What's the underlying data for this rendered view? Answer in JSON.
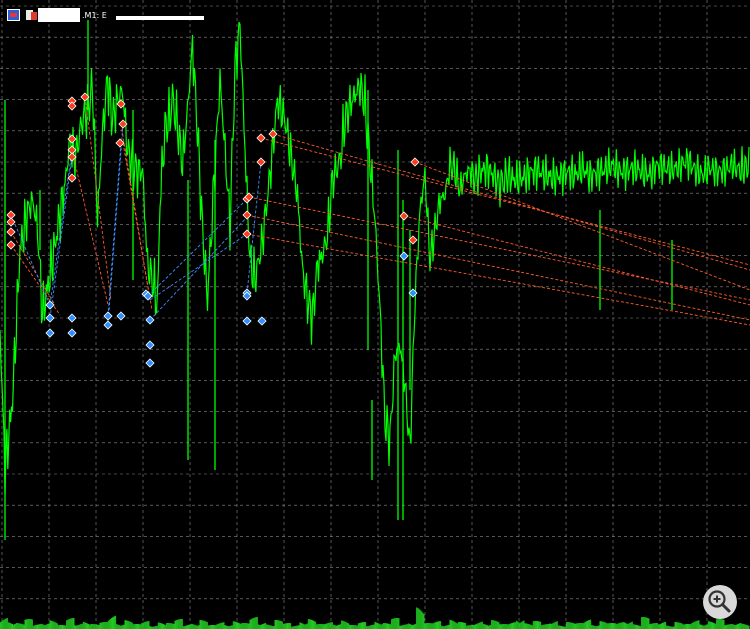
{
  "window": {
    "symbol_label": ".M1: E",
    "chart_icon": "chart-window-icon",
    "doc_icon": "document-icon",
    "zoom_icon": "zoom-in-icon"
  },
  "colors": {
    "background": "#000000",
    "grid": "#8a8a8a",
    "price": "#00ff00",
    "volume": "#22cc22",
    "high_marker": "#ff3b1f",
    "low_marker": "#2f8fff",
    "high_trendline": "#ff5a2a",
    "low_trendline": "#3b8fff"
  },
  "chart_data": {
    "type": "line",
    "title": "",
    "xlabel": "",
    "ylabel": "",
    "grid": true,
    "price_series": [
      [
        0,
        330
      ],
      [
        0.02,
        470
      ],
      [
        0.05,
        400
      ],
      [
        0.08,
        250
      ],
      [
        0.11,
        212
      ],
      [
        0.13,
        200
      ],
      [
        0.15,
        228
      ],
      [
        0.17,
        315
      ],
      [
        0.2,
        275
      ],
      [
        0.23,
        230
      ],
      [
        0.26,
        184
      ],
      [
        0.28,
        140
      ],
      [
        0.3,
        160
      ],
      [
        0.33,
        118
      ],
      [
        0.35,
        112
      ],
      [
        0.37,
        86
      ],
      [
        0.39,
        220
      ],
      [
        0.41,
        132
      ],
      [
        0.43,
        80
      ],
      [
        0.45,
        120
      ],
      [
        0.47,
        100
      ],
      [
        0.49,
        90
      ],
      [
        0.51,
        150
      ],
      [
        0.53,
        165
      ],
      [
        0.55,
        172
      ],
      [
        0.57,
        170
      ],
      [
        0.59,
        265
      ],
      [
        0.61,
        280
      ],
      [
        0.63,
        305
      ],
      [
        0.64,
        200
      ],
      [
        0.66,
        130
      ],
      [
        0.68,
        115
      ],
      [
        0.69,
        100
      ],
      [
        0.71,
        125
      ],
      [
        0.73,
        165
      ],
      [
        0.75,
        110
      ],
      [
        0.77,
        45
      ],
      [
        0.79,
        130
      ],
      [
        0.81,
        230
      ],
      [
        0.83,
        300
      ],
      [
        0.84,
        255
      ],
      [
        0.86,
        165
      ],
      [
        0.88,
        80
      ],
      [
        0.9,
        150
      ],
      [
        0.92,
        225
      ],
      [
        0.94,
        70
      ],
      [
        0.96,
        24
      ],
      [
        0.98,
        150
      ],
      [
        1.0,
        260
      ],
      [
        1.02,
        280
      ],
      [
        1.05,
        240
      ],
      [
        1.08,
        175
      ],
      [
        1.11,
        100
      ],
      [
        1.14,
        120
      ],
      [
        1.17,
        165
      ],
      [
        1.19,
        195
      ],
      [
        1.21,
        270
      ],
      [
        1.23,
        300
      ],
      [
        1.25,
        318
      ],
      [
        1.27,
        265
      ],
      [
        1.29,
        255
      ],
      [
        1.31,
        235
      ],
      [
        1.33,
        180
      ],
      [
        1.36,
        160
      ],
      [
        1.38,
        120
      ],
      [
        1.4,
        105
      ],
      [
        1.42,
        95
      ],
      [
        1.44,
        85
      ],
      [
        1.46,
        105
      ],
      [
        1.48,
        160
      ],
      [
        1.5,
        220
      ],
      [
        1.52,
        310
      ],
      [
        1.54,
        420
      ],
      [
        1.56,
        440
      ],
      [
        1.58,
        355
      ],
      [
        1.6,
        345
      ],
      [
        1.62,
        385
      ],
      [
        1.64,
        450
      ],
      [
        1.66,
        300
      ],
      [
        1.68,
        210
      ],
      [
        1.7,
        175
      ],
      [
        1.72,
        260
      ],
      [
        1.74,
        230
      ],
      [
        1.76,
        200
      ],
      [
        1.78,
        195
      ],
      [
        1.8,
        165
      ],
      [
        1.82,
        170
      ],
      [
        1.84,
        190
      ],
      [
        1.86,
        175
      ],
      [
        1.88,
        170
      ],
      [
        1.9,
        180
      ],
      [
        1.92,
        172
      ],
      [
        1.95,
        168
      ],
      [
        1.98,
        178
      ],
      [
        2.0,
        185
      ],
      [
        2.03,
        175
      ],
      [
        2.06,
        180
      ],
      [
        2.09,
        178
      ],
      [
        2.12,
        172
      ],
      [
        2.15,
        170
      ],
      [
        2.18,
        175
      ],
      [
        2.21,
        178
      ],
      [
        2.24,
        176
      ],
      [
        2.27,
        172
      ],
      [
        2.3,
        175
      ],
      [
        2.33,
        168
      ],
      [
        2.36,
        176
      ],
      [
        2.39,
        172
      ],
      [
        2.42,
        170
      ],
      [
        2.45,
        165
      ],
      [
        2.48,
        172
      ],
      [
        2.51,
        170
      ],
      [
        2.54,
        168
      ],
      [
        2.57,
        172
      ],
      [
        2.6,
        175
      ],
      [
        2.63,
        165
      ],
      [
        2.66,
        168
      ],
      [
        2.69,
        170
      ],
      [
        2.72,
        166
      ],
      [
        2.75,
        160
      ],
      [
        2.78,
        170
      ],
      [
        2.81,
        175
      ],
      [
        2.84,
        168
      ],
      [
        2.87,
        172
      ],
      [
        2.9,
        170
      ],
      [
        2.93,
        165
      ],
      [
        2.96,
        170
      ],
      [
        3.0,
        165
      ]
    ],
    "volume_bars": [
      12,
      8,
      6,
      10,
      5,
      7,
      9,
      4,
      11,
      6,
      8,
      5,
      7,
      14,
      6,
      9,
      5,
      8,
      4,
      7,
      6,
      10,
      5,
      6,
      9,
      4,
      7,
      5,
      8,
      6,
      12,
      7,
      5,
      9,
      6,
      4,
      8,
      10,
      5,
      7,
      6,
      9,
      4,
      7,
      5,
      8,
      6,
      11,
      5,
      7,
      22,
      6,
      8,
      5,
      10,
      7,
      4,
      8,
      6,
      9,
      5,
      7,
      11,
      6,
      8,
      5,
      9,
      4,
      7,
      6,
      10,
      5,
      8,
      6,
      7,
      9,
      5,
      12,
      6,
      8,
      4,
      7,
      5,
      9,
      6,
      8,
      10,
      5,
      7,
      6
    ],
    "high_markers": [
      [
        11,
        215
      ],
      [
        11,
        222
      ],
      [
        11,
        232
      ],
      [
        11,
        245
      ],
      [
        72,
        101
      ],
      [
        72,
        106
      ],
      [
        72,
        139
      ],
      [
        72,
        150
      ],
      [
        72,
        157
      ],
      [
        72,
        178
      ],
      [
        85,
        97
      ],
      [
        121,
        104
      ],
      [
        123,
        124
      ],
      [
        120,
        143
      ],
      [
        261,
        138
      ],
      [
        261,
        162
      ],
      [
        273,
        134
      ],
      [
        247,
        199
      ],
      [
        249,
        197
      ],
      [
        247,
        215
      ],
      [
        247,
        234
      ],
      [
        404,
        216
      ],
      [
        413,
        240
      ],
      [
        415,
        162
      ]
    ],
    "low_markers": [
      [
        50,
        305
      ],
      [
        50,
        318
      ],
      [
        50,
        333
      ],
      [
        72,
        318
      ],
      [
        72,
        333
      ],
      [
        108,
        316
      ],
      [
        108,
        325
      ],
      [
        121,
        316
      ],
      [
        146,
        294
      ],
      [
        148,
        296
      ],
      [
        150,
        320
      ],
      [
        150,
        345
      ],
      [
        150,
        363
      ],
      [
        247,
        293
      ],
      [
        247,
        296
      ],
      [
        247,
        321
      ],
      [
        262,
        321
      ],
      [
        404,
        256
      ],
      [
        413,
        293
      ]
    ],
    "high_trendlines": [
      [
        [
          11,
          232
        ],
        [
          55,
          305
        ]
      ],
      [
        [
          11,
          245
        ],
        [
          60,
          315
        ]
      ],
      [
        [
          72,
          150
        ],
        [
          108,
          305
        ]
      ],
      [
        [
          85,
          97
        ],
        [
          111,
          300
        ]
      ],
      [
        [
          121,
          124
        ],
        [
          150,
          300
        ]
      ],
      [
        [
          123,
          143
        ],
        [
          152,
          310
        ]
      ],
      [
        [
          261,
          138
        ],
        [
          750,
          265
        ]
      ],
      [
        [
          273,
          134
        ],
        [
          750,
          270
        ]
      ],
      [
        [
          249,
          197
        ],
        [
          750,
          300
        ]
      ],
      [
        [
          247,
          215
        ],
        [
          750,
          320
        ]
      ],
      [
        [
          415,
          162
        ],
        [
          750,
          290
        ]
      ],
      [
        [
          404,
          216
        ],
        [
          750,
          305
        ]
      ],
      [
        [
          247,
          234
        ],
        [
          750,
          325
        ]
      ]
    ],
    "low_trendlines": [
      [
        [
          11,
          215
        ],
        [
          50,
          305
        ]
      ],
      [
        [
          50,
          305
        ],
        [
          72,
          150
        ]
      ],
      [
        [
          50,
          318
        ],
        [
          72,
          157
        ]
      ],
      [
        [
          108,
          316
        ],
        [
          121,
          143
        ]
      ],
      [
        [
          148,
          296
        ],
        [
          247,
          199
        ]
      ],
      [
        [
          150,
          320
        ],
        [
          249,
          215
        ]
      ],
      [
        [
          150,
          300
        ],
        [
          247,
          234
        ]
      ],
      [
        [
          247,
          293
        ],
        [
          261,
          162
        ]
      ],
      [
        [
          108,
          325
        ],
        [
          123,
          124
        ]
      ]
    ]
  }
}
